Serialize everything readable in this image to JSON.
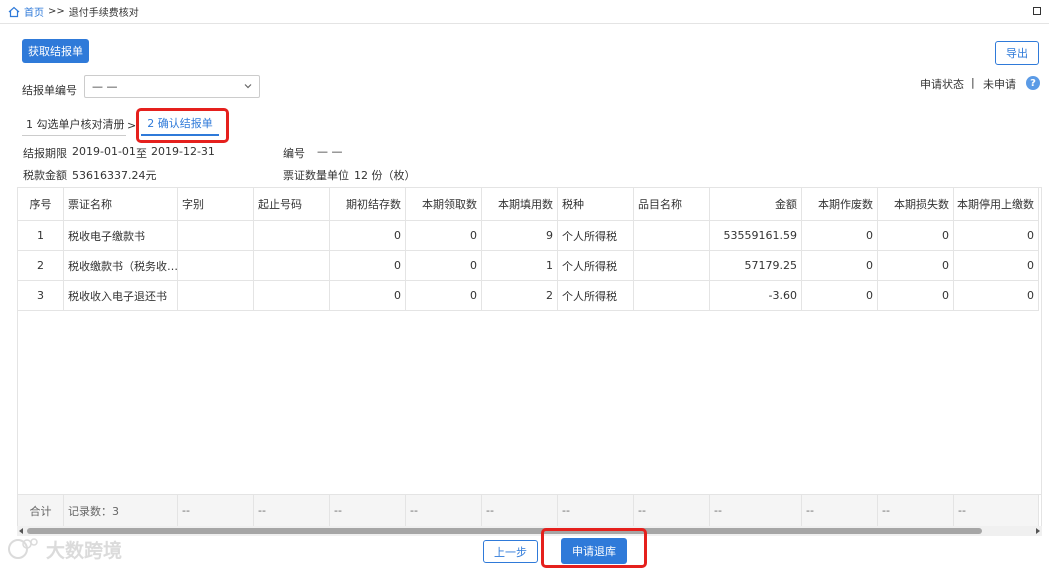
{
  "breadcrumb": {
    "home": "首页",
    "sep": ">>",
    "current": "退付手续费核对"
  },
  "toolbar": {
    "fetch_label": "获取结报单",
    "export_label": "导出"
  },
  "form": {
    "report_no_label": "结报单编号",
    "report_no_value": "— —",
    "status_label": "申请状态",
    "status_sep": "|",
    "status_value": "未申请",
    "help": "?"
  },
  "steps": [
    {
      "label": "1 勾选单户核对清册"
    },
    {
      "label": "2 确认结报单"
    }
  ],
  "step_arrow": ">",
  "info": {
    "period_label": "结报期限",
    "period_start": "2019-01-01",
    "period_to": "至",
    "period_end": "2019-12-31",
    "no_label": "编号",
    "no_value": "— —",
    "amount_label": "税款金额",
    "amount_value": "53616337.24元",
    "unit_label": "票证数量单位",
    "unit_value": "12 份（枚）"
  },
  "table": {
    "headers": [
      "序号",
      "票证名称",
      "字别",
      "起止号码",
      "期初结存数",
      "本期领取数",
      "本期填用数",
      "税种",
      "品目名称",
      "金额",
      "本期作废数",
      "本期损失数",
      "本期停用上缴数"
    ],
    "rows": [
      [
        "1",
        "税收电子缴款书",
        "",
        "",
        "0",
        "0",
        "9",
        "个人所得税",
        "",
        "53559161.59",
        "0",
        "0",
        "0"
      ],
      [
        "2",
        "税收缴款书（税务收…",
        "",
        "",
        "0",
        "0",
        "1",
        "个人所得税",
        "",
        "57179.25",
        "0",
        "0",
        "0"
      ],
      [
        "3",
        "税收收入电子退还书",
        "",
        "",
        "0",
        "0",
        "2",
        "个人所得税",
        "",
        "-3.60",
        "0",
        "0",
        "0"
      ]
    ],
    "footer": [
      "合计",
      "记录数：3",
      "--",
      "--",
      "--",
      "--",
      "--",
      "--",
      "--",
      "--",
      "--",
      "--",
      "--"
    ]
  },
  "actions": {
    "prev_label": "上一步",
    "apply_label": "申请退库"
  },
  "watermark": "大数跨境",
  "colors": {
    "accent": "#2f7ad9",
    "highlight": "#e5201d"
  }
}
